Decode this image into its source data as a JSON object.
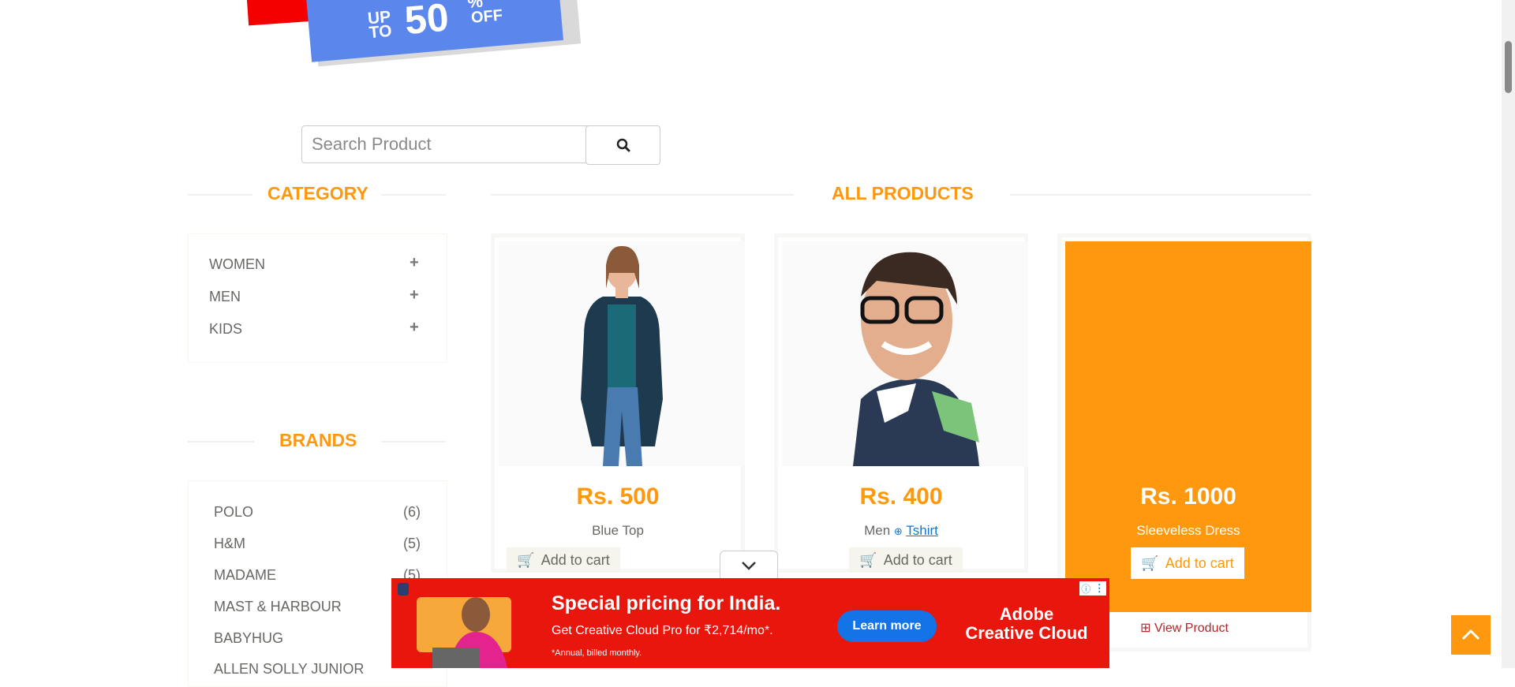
{
  "promo": {
    "up_to": "UP TO",
    "percent": "50",
    "pct_sign": "%",
    "off": "OFF"
  },
  "search": {
    "placeholder": "Search Product"
  },
  "headings": {
    "category": "CATEGORY",
    "all_products": "ALL PRODUCTS",
    "brands": "BRANDS"
  },
  "categories": [
    {
      "label": "WOMEN"
    },
    {
      "label": "MEN"
    },
    {
      "label": "KIDS"
    }
  ],
  "brands": [
    {
      "name": "POLO",
      "count": "(6)"
    },
    {
      "name": "H&M",
      "count": "(5)"
    },
    {
      "name": "MADAME",
      "count": "(5)"
    },
    {
      "name": "MAST & HARBOUR",
      "count": ""
    },
    {
      "name": "BABYHUG",
      "count": ""
    },
    {
      "name": "ALLEN SOLLY JUNIOR",
      "count": ""
    }
  ],
  "products": [
    {
      "price": "Rs. 500",
      "name": "Blue Top",
      "cart": "Add to cart"
    },
    {
      "price": "Rs. 400",
      "name_prefix": "Men",
      "name_link": "Tshirt",
      "cart": "Add to cart"
    },
    {
      "price": "Rs. 1000",
      "name": "Sleeveless Dress",
      "cart": "Add to cart",
      "view": "View Product"
    }
  ],
  "ad": {
    "title": "Special pricing for India.",
    "subtitle": "Get Creative Cloud Pro for ₹2,714/mo*.",
    "note": "*Annual, billed monthly.",
    "cta": "Learn more",
    "brand_line1": "Adobe",
    "brand_line2": "Creative Cloud",
    "icons": [
      "adchoices-icon",
      "shield-icon",
      "more-vert-icon",
      "chevron-down-icon"
    ]
  },
  "colors": {
    "accent": "#fe980f",
    "ad_bg": "#e8160d",
    "ad_cta": "#1473e6",
    "promo_blue": "#5b87ed"
  }
}
